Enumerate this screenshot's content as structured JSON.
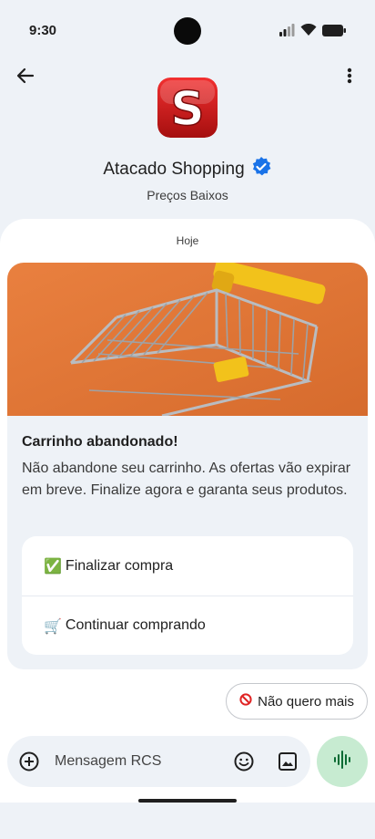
{
  "status_bar": {
    "time": "9:30",
    "icons": [
      "signal-icon",
      "wifi-icon",
      "battery-icon"
    ]
  },
  "header": {
    "back_icon": "arrow-left-icon",
    "menu_icon": "more-vert-icon",
    "brand_name": "Atacado Shopping",
    "verified_icon": "verified-badge-icon",
    "brand_subtitle": "Preços Baixos",
    "logo_letter": "S"
  },
  "chat": {
    "day_label": "Hoje",
    "card": {
      "title": "Carrinho abandonado!",
      "text": "Não abandone seu carrinho. As ofertas vão expirar em breve. Finalize agora e garanta seus produtos.",
      "actions": [
        {
          "icon": "✅",
          "label": "Finalizar compra"
        },
        {
          "icon": "🛒",
          "label": "Continuar comprando"
        }
      ]
    },
    "suggestion_chip": {
      "icon": "🚫",
      "label": "Não quero mais"
    }
  },
  "composer": {
    "placeholder": "Mensagem RCS",
    "value": ""
  },
  "colors": {
    "background": "#eef2f7",
    "chat_background": "#ffffff",
    "verified_blue": "#1a73e8",
    "mic_green": "#c7ebd1",
    "logo_red": "#d91a1a",
    "image_orange": "#e8874b",
    "cart_handle": "#f2c21b"
  }
}
